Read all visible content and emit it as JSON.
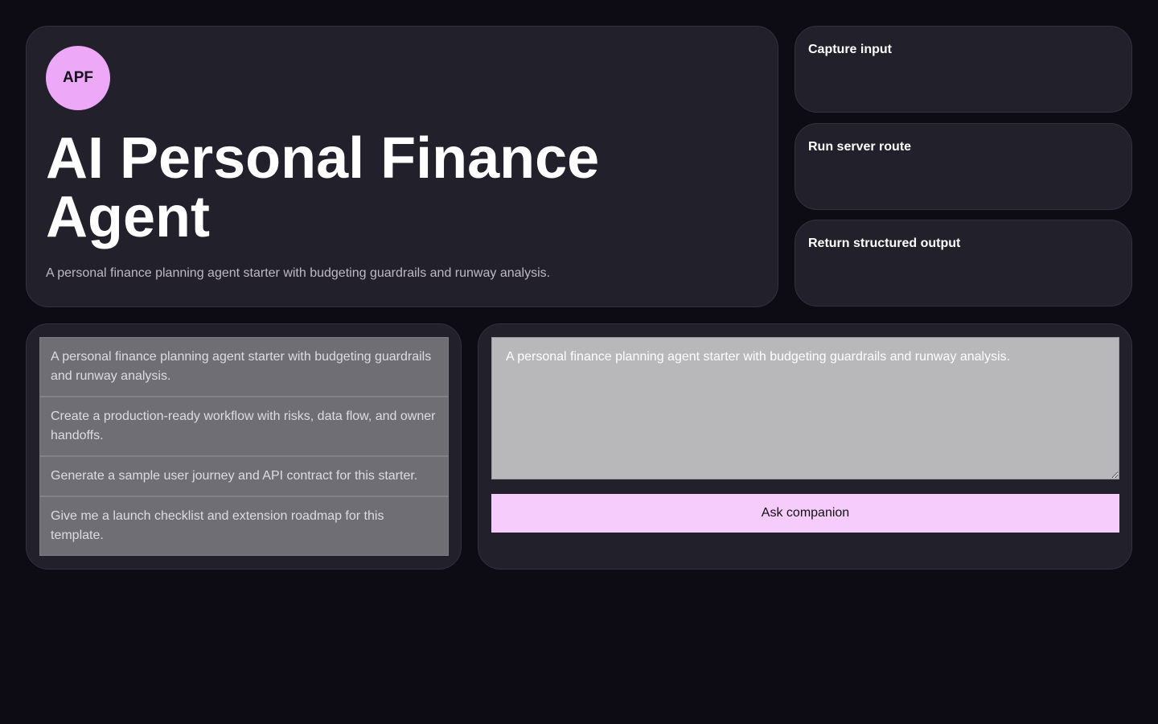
{
  "hero": {
    "avatar_text": "APF",
    "title": "AI Personal Finance Agent",
    "description": "A personal finance planning agent starter with budgeting guardrails and runway analysis."
  },
  "steps": [
    {
      "title": "Capture input"
    },
    {
      "title": "Run server route"
    },
    {
      "title": "Return structured output"
    }
  ],
  "prompts": [
    "A personal finance planning agent starter with budgeting guardrails and runway analysis.",
    "Create a production-ready workflow with risks, data flow, and owner handoffs.",
    "Generate a sample user journey and API contract for this starter.",
    "Give me a launch checklist and extension roadmap for this template."
  ],
  "composer": {
    "value": "A personal finance planning agent starter with budgeting guardrails and runway analysis.",
    "button_label": "Ask companion"
  },
  "colors": {
    "background": "#0d0b14",
    "card": "#22202b",
    "accent": "#eea8f8",
    "button": "#f6ccfc"
  }
}
